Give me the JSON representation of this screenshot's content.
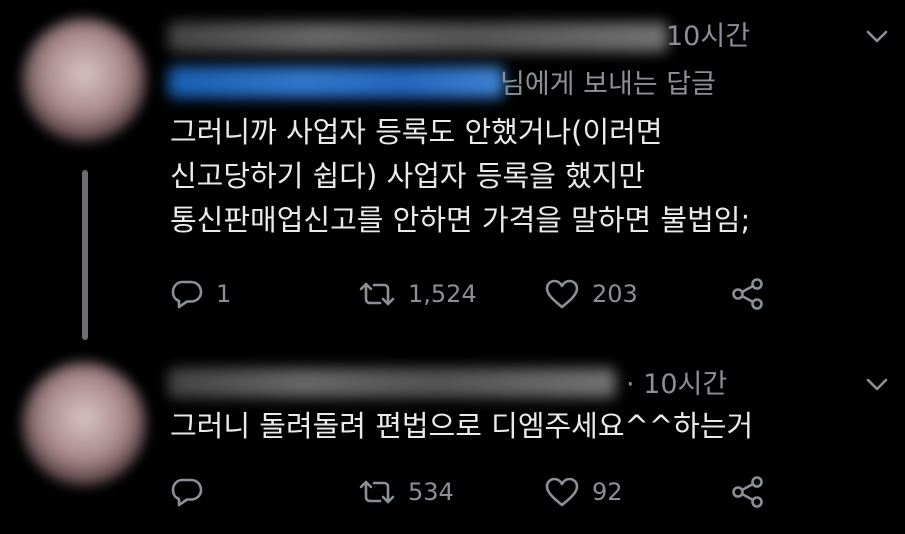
{
  "tweets": [
    {
      "time": "10시간",
      "reply_to_suffix": "님에게 보내는 답글",
      "text_lines": [
        "그러니까 사업자 등록도 안했거나(이러면",
        "신고당하기 쉽다) 사업자 등록을 했지만",
        "통신판매업신고를 안하면 가격을 말하면 불법임;"
      ],
      "replies": "1",
      "retweets": "1,524",
      "likes": "203"
    },
    {
      "time": "· 10시간",
      "text_lines": [
        "그러니 돌려돌려 편법으로 디엠주세요^^하는거"
      ],
      "replies": "",
      "retweets": "534",
      "likes": "92"
    }
  ],
  "icons": {
    "reply": "reply-icon",
    "retweet": "retweet-icon",
    "like": "heart-icon",
    "share": "share-icon",
    "menu": "chevron-down-icon"
  },
  "colors": {
    "background": "#000000",
    "text": "#eaeaea",
    "secondary": "#8b9097",
    "thread_line": "#6a6e72"
  }
}
